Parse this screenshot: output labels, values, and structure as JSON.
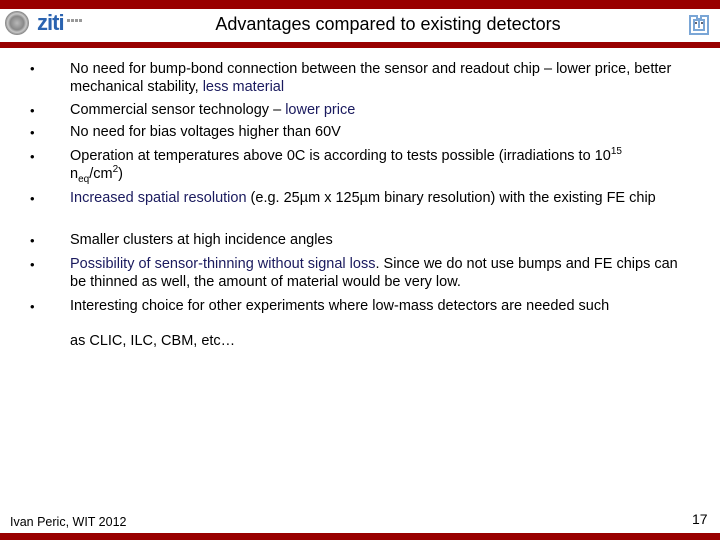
{
  "header": {
    "title": "Advantages compared to existing detectors",
    "logo_left_text": "ziti",
    "colors": {
      "bar": "#990000",
      "emphasis": "#1a1a5e",
      "logo": "#2a63b0"
    }
  },
  "bullets": [
    {
      "parts": [
        "No need for bump-bond connection between the sensor and readout chip – lower price, better mechanical stability, ",
        "less material"
      ]
    },
    {
      "parts": [
        "Commercial sensor technology – ",
        "lower price"
      ]
    },
    {
      "parts": [
        "No need for bias voltages higher than 60V"
      ]
    },
    {
      "parts": [
        "Operation at temperatures above 0C is according to tests possible (irradiations to 10",
        "15",
        " n",
        "eq",
        "/cm",
        "2",
        ")"
      ]
    },
    {
      "parts": [
        "Increased spatial resolution",
        " (e.g. 25µm x 125µm binary resolution) with the existing FE chip"
      ]
    },
    {
      "parts": [
        "Smaller clusters at high incidence angles"
      ]
    },
    {
      "parts": [
        "Possibility of sensor-thinning without signal loss",
        ". Since we do not use bumps and FE chips can be thinned as well, the amount of material would be very low."
      ]
    },
    {
      "parts": [
        "Interesting choice for other experiments where low-mass detectors are needed such",
        "as CLIC, ILC, CBM, etc…"
      ]
    }
  ],
  "bullet_symbol": "•",
  "footer": {
    "author": "Ivan Peric, WIT 2012",
    "page_number": "17"
  }
}
